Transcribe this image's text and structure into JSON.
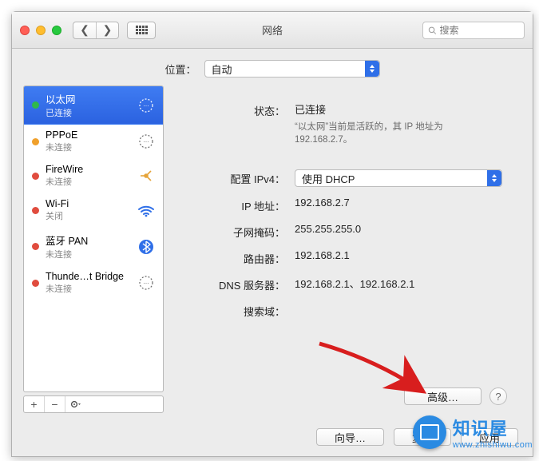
{
  "window": {
    "title": "网络",
    "search_placeholder": "搜索"
  },
  "location": {
    "label": "位置：",
    "value": "自动"
  },
  "sidebar": {
    "items": [
      {
        "name": "以太网",
        "status": "已连接",
        "dot": "green",
        "icon": "ethernet",
        "selected": true
      },
      {
        "name": "PPPoE",
        "status": "未连接",
        "dot": "orange",
        "icon": "ethernet",
        "selected": false
      },
      {
        "name": "FireWire",
        "status": "未连接",
        "dot": "red",
        "icon": "firewire",
        "selected": false
      },
      {
        "name": "Wi-Fi",
        "status": "关闭",
        "dot": "red",
        "icon": "wifi",
        "selected": false
      },
      {
        "name": "蓝牙 PAN",
        "status": "未连接",
        "dot": "red",
        "icon": "bluetooth",
        "selected": false
      },
      {
        "name": "Thunde…t Bridge",
        "status": "未连接",
        "dot": "red",
        "icon": "ethernet",
        "selected": false
      }
    ]
  },
  "detail": {
    "status_label": "状态：",
    "status_value": "已连接",
    "status_desc": "“以太网”当前是活跃的，其 IP 地址为 192.168.2.7。",
    "config_label": "配置 IPv4：",
    "config_value": "使用 DHCP",
    "ip_label": "IP 地址：",
    "ip_value": "192.168.2.7",
    "mask_label": "子网掩码：",
    "mask_value": "255.255.255.0",
    "router_label": "路由器：",
    "router_value": "192.168.2.1",
    "dns_label": "DNS 服务器：",
    "dns_value": "192.168.2.1、192.168.2.1",
    "search_label": "搜索域：",
    "search_value": "",
    "advanced_btn": "高级…",
    "help": "?"
  },
  "bottom": {
    "assist": "向导…",
    "revert": "复原",
    "apply": "应用"
  },
  "watermark": {
    "cn": "知识屋",
    "en": "www.zhishiwu.com"
  }
}
